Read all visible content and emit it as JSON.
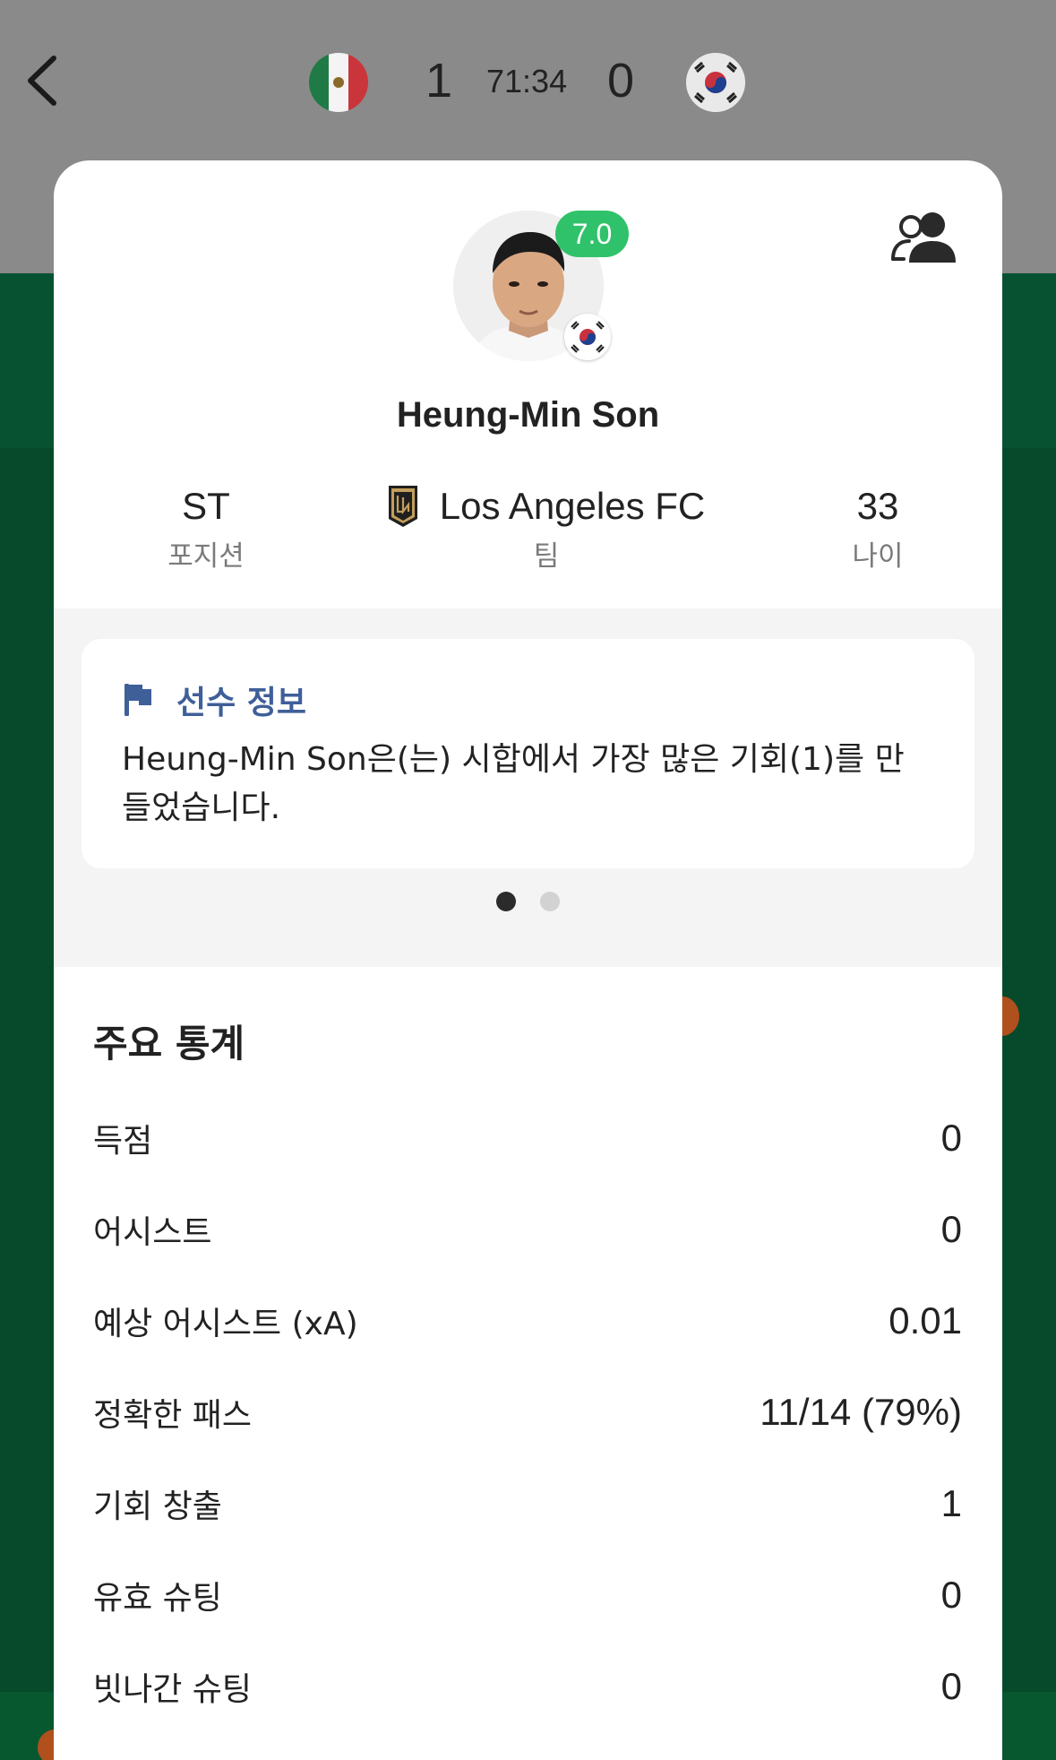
{
  "match": {
    "home_score": "1",
    "clock": "71:34",
    "away_score": "0"
  },
  "player": {
    "rating": "7.0",
    "name": "Heung-Min Son",
    "position_value": "ST",
    "position_label": "포지션",
    "team_value": "Los Angeles FC",
    "team_label": "팀",
    "age_value": "33",
    "age_label": "나이"
  },
  "insight": {
    "title": "선수 정보",
    "text": "Heung-Min Son은(는) 시합에서 가장 많은 기회(1)를 만들었습니다.",
    "page_count": 2,
    "active_page": 1
  },
  "stats": {
    "title": "주요 통계",
    "rows": [
      {
        "label": "득점",
        "value": "0"
      },
      {
        "label": "어시스트",
        "value": "0"
      },
      {
        "label": "예상 어시스트 (xA)",
        "value": "0.01"
      },
      {
        "label": "정확한 패스",
        "value": "11/14 (79%)"
      },
      {
        "label": "기회 창출",
        "value": "1"
      },
      {
        "label": "유효 슈팅",
        "value": "0"
      },
      {
        "label": "빗나간 슈팅",
        "value": "0"
      }
    ]
  },
  "icons": {
    "back": "chevron-left-icon",
    "compare": "people-icon",
    "insight": "flag-icon"
  },
  "colors": {
    "rating_badge": "#30c26a",
    "insight_title": "#3f5f99",
    "background_green": "#064a2b"
  }
}
